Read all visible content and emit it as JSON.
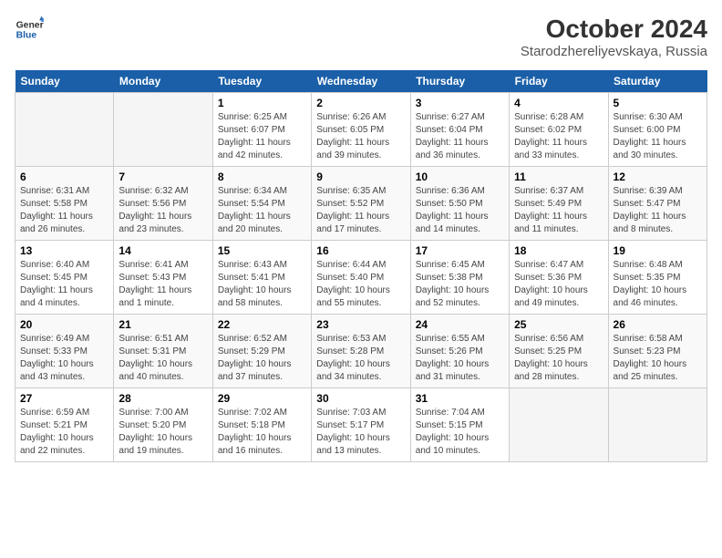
{
  "logo": {
    "line1": "General",
    "line2": "Blue"
  },
  "title": "October 2024",
  "subtitle": "Starodzhereliyevskaya, Russia",
  "days_header": [
    "Sunday",
    "Monday",
    "Tuesday",
    "Wednesday",
    "Thursday",
    "Friday",
    "Saturday"
  ],
  "weeks": [
    [
      {
        "day": "",
        "sunrise": "",
        "sunset": "",
        "daylight": ""
      },
      {
        "day": "",
        "sunrise": "",
        "sunset": "",
        "daylight": ""
      },
      {
        "day": "1",
        "sunrise": "Sunrise: 6:25 AM",
        "sunset": "Sunset: 6:07 PM",
        "daylight": "Daylight: 11 hours and 42 minutes."
      },
      {
        "day": "2",
        "sunrise": "Sunrise: 6:26 AM",
        "sunset": "Sunset: 6:05 PM",
        "daylight": "Daylight: 11 hours and 39 minutes."
      },
      {
        "day": "3",
        "sunrise": "Sunrise: 6:27 AM",
        "sunset": "Sunset: 6:04 PM",
        "daylight": "Daylight: 11 hours and 36 minutes."
      },
      {
        "day": "4",
        "sunrise": "Sunrise: 6:28 AM",
        "sunset": "Sunset: 6:02 PM",
        "daylight": "Daylight: 11 hours and 33 minutes."
      },
      {
        "day": "5",
        "sunrise": "Sunrise: 6:30 AM",
        "sunset": "Sunset: 6:00 PM",
        "daylight": "Daylight: 11 hours and 30 minutes."
      }
    ],
    [
      {
        "day": "6",
        "sunrise": "Sunrise: 6:31 AM",
        "sunset": "Sunset: 5:58 PM",
        "daylight": "Daylight: 11 hours and 26 minutes."
      },
      {
        "day": "7",
        "sunrise": "Sunrise: 6:32 AM",
        "sunset": "Sunset: 5:56 PM",
        "daylight": "Daylight: 11 hours and 23 minutes."
      },
      {
        "day": "8",
        "sunrise": "Sunrise: 6:34 AM",
        "sunset": "Sunset: 5:54 PM",
        "daylight": "Daylight: 11 hours and 20 minutes."
      },
      {
        "day": "9",
        "sunrise": "Sunrise: 6:35 AM",
        "sunset": "Sunset: 5:52 PM",
        "daylight": "Daylight: 11 hours and 17 minutes."
      },
      {
        "day": "10",
        "sunrise": "Sunrise: 6:36 AM",
        "sunset": "Sunset: 5:50 PM",
        "daylight": "Daylight: 11 hours and 14 minutes."
      },
      {
        "day": "11",
        "sunrise": "Sunrise: 6:37 AM",
        "sunset": "Sunset: 5:49 PM",
        "daylight": "Daylight: 11 hours and 11 minutes."
      },
      {
        "day": "12",
        "sunrise": "Sunrise: 6:39 AM",
        "sunset": "Sunset: 5:47 PM",
        "daylight": "Daylight: 11 hours and 8 minutes."
      }
    ],
    [
      {
        "day": "13",
        "sunrise": "Sunrise: 6:40 AM",
        "sunset": "Sunset: 5:45 PM",
        "daylight": "Daylight: 11 hours and 4 minutes."
      },
      {
        "day": "14",
        "sunrise": "Sunrise: 6:41 AM",
        "sunset": "Sunset: 5:43 PM",
        "daylight": "Daylight: 11 hours and 1 minute."
      },
      {
        "day": "15",
        "sunrise": "Sunrise: 6:43 AM",
        "sunset": "Sunset: 5:41 PM",
        "daylight": "Daylight: 10 hours and 58 minutes."
      },
      {
        "day": "16",
        "sunrise": "Sunrise: 6:44 AM",
        "sunset": "Sunset: 5:40 PM",
        "daylight": "Daylight: 10 hours and 55 minutes."
      },
      {
        "day": "17",
        "sunrise": "Sunrise: 6:45 AM",
        "sunset": "Sunset: 5:38 PM",
        "daylight": "Daylight: 10 hours and 52 minutes."
      },
      {
        "day": "18",
        "sunrise": "Sunrise: 6:47 AM",
        "sunset": "Sunset: 5:36 PM",
        "daylight": "Daylight: 10 hours and 49 minutes."
      },
      {
        "day": "19",
        "sunrise": "Sunrise: 6:48 AM",
        "sunset": "Sunset: 5:35 PM",
        "daylight": "Daylight: 10 hours and 46 minutes."
      }
    ],
    [
      {
        "day": "20",
        "sunrise": "Sunrise: 6:49 AM",
        "sunset": "Sunset: 5:33 PM",
        "daylight": "Daylight: 10 hours and 43 minutes."
      },
      {
        "day": "21",
        "sunrise": "Sunrise: 6:51 AM",
        "sunset": "Sunset: 5:31 PM",
        "daylight": "Daylight: 10 hours and 40 minutes."
      },
      {
        "day": "22",
        "sunrise": "Sunrise: 6:52 AM",
        "sunset": "Sunset: 5:29 PM",
        "daylight": "Daylight: 10 hours and 37 minutes."
      },
      {
        "day": "23",
        "sunrise": "Sunrise: 6:53 AM",
        "sunset": "Sunset: 5:28 PM",
        "daylight": "Daylight: 10 hours and 34 minutes."
      },
      {
        "day": "24",
        "sunrise": "Sunrise: 6:55 AM",
        "sunset": "Sunset: 5:26 PM",
        "daylight": "Daylight: 10 hours and 31 minutes."
      },
      {
        "day": "25",
        "sunrise": "Sunrise: 6:56 AM",
        "sunset": "Sunset: 5:25 PM",
        "daylight": "Daylight: 10 hours and 28 minutes."
      },
      {
        "day": "26",
        "sunrise": "Sunrise: 6:58 AM",
        "sunset": "Sunset: 5:23 PM",
        "daylight": "Daylight: 10 hours and 25 minutes."
      }
    ],
    [
      {
        "day": "27",
        "sunrise": "Sunrise: 6:59 AM",
        "sunset": "Sunset: 5:21 PM",
        "daylight": "Daylight: 10 hours and 22 minutes."
      },
      {
        "day": "28",
        "sunrise": "Sunrise: 7:00 AM",
        "sunset": "Sunset: 5:20 PM",
        "daylight": "Daylight: 10 hours and 19 minutes."
      },
      {
        "day": "29",
        "sunrise": "Sunrise: 7:02 AM",
        "sunset": "Sunset: 5:18 PM",
        "daylight": "Daylight: 10 hours and 16 minutes."
      },
      {
        "day": "30",
        "sunrise": "Sunrise: 7:03 AM",
        "sunset": "Sunset: 5:17 PM",
        "daylight": "Daylight: 10 hours and 13 minutes."
      },
      {
        "day": "31",
        "sunrise": "Sunrise: 7:04 AM",
        "sunset": "Sunset: 5:15 PM",
        "daylight": "Daylight: 10 hours and 10 minutes."
      },
      {
        "day": "",
        "sunrise": "",
        "sunset": "",
        "daylight": ""
      },
      {
        "day": "",
        "sunrise": "",
        "sunset": "",
        "daylight": ""
      }
    ]
  ]
}
